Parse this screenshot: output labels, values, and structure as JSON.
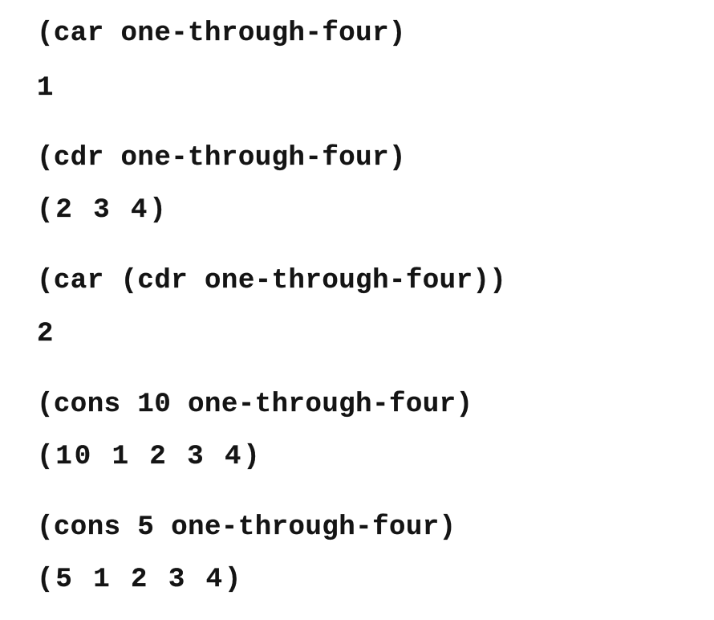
{
  "examples": [
    {
      "expression": "(car one-through-four)",
      "result": "1"
    },
    {
      "expression": "(cdr one-through-four)",
      "result": "(2 3 4)"
    },
    {
      "expression": "(car (cdr one-through-four))",
      "result": "2"
    },
    {
      "expression": "(cons 10 one-through-four)",
      "result": "(10 1 2 3 4)"
    },
    {
      "expression": "(cons 5 one-through-four)",
      "result": "(5 1 2 3 4)"
    }
  ]
}
